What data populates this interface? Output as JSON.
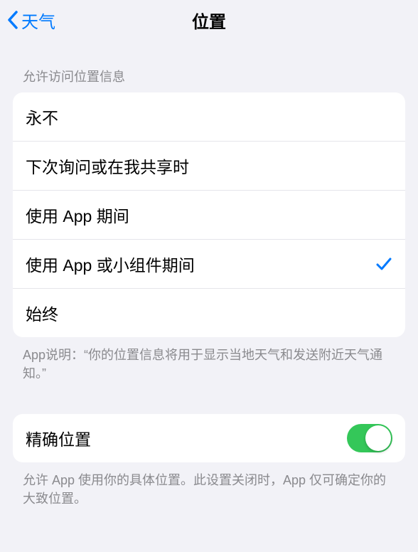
{
  "header": {
    "back_label": "天气",
    "title": "位置"
  },
  "location_access": {
    "header": "允许访问位置信息",
    "options": {
      "never": "永不",
      "ask_next_time": "下次询问或在我共享时",
      "while_using": "使用 App 期间",
      "while_using_or_widgets": "使用 App 或小组件期间",
      "always": "始终"
    },
    "selected": "while_using_or_widgets",
    "footer": "App说明：“你的位置信息将用于显示当地天气和发送附近天气通知。”"
  },
  "precise_location": {
    "label": "精确位置",
    "enabled": true,
    "footer": "允许 App 使用你的具体位置。此设置关闭时，App 仅可确定你的大致位置。"
  }
}
